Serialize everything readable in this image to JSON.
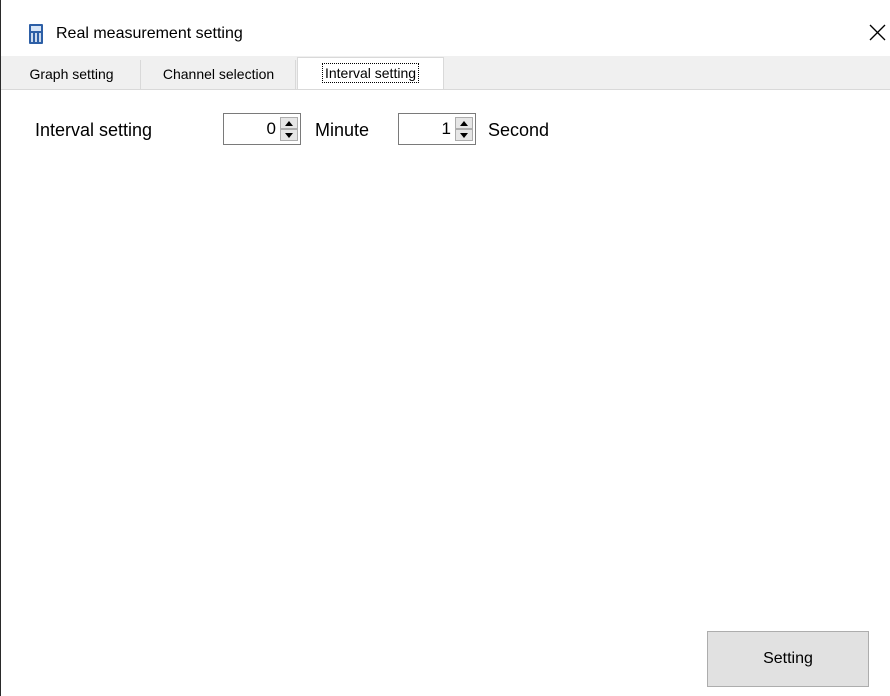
{
  "window": {
    "title": "Real measurement setting",
    "icon": "calculator-icon",
    "close_icon": "close-icon"
  },
  "tabs": [
    {
      "label": "Graph setting",
      "active": false
    },
    {
      "label": "Channel selection",
      "active": false
    },
    {
      "label": "Interval setting",
      "active": true
    }
  ],
  "interval": {
    "label": "Interval setting",
    "minute_value": "0",
    "minute_unit": "Minute",
    "second_value": "1",
    "second_unit": "Second"
  },
  "footer": {
    "setting_button": "Setting"
  },
  "colors": {
    "tab_strip_bg": "#f0f0f0",
    "button_bg": "#e1e1e1",
    "icon_blue": "#2d5fa6"
  }
}
